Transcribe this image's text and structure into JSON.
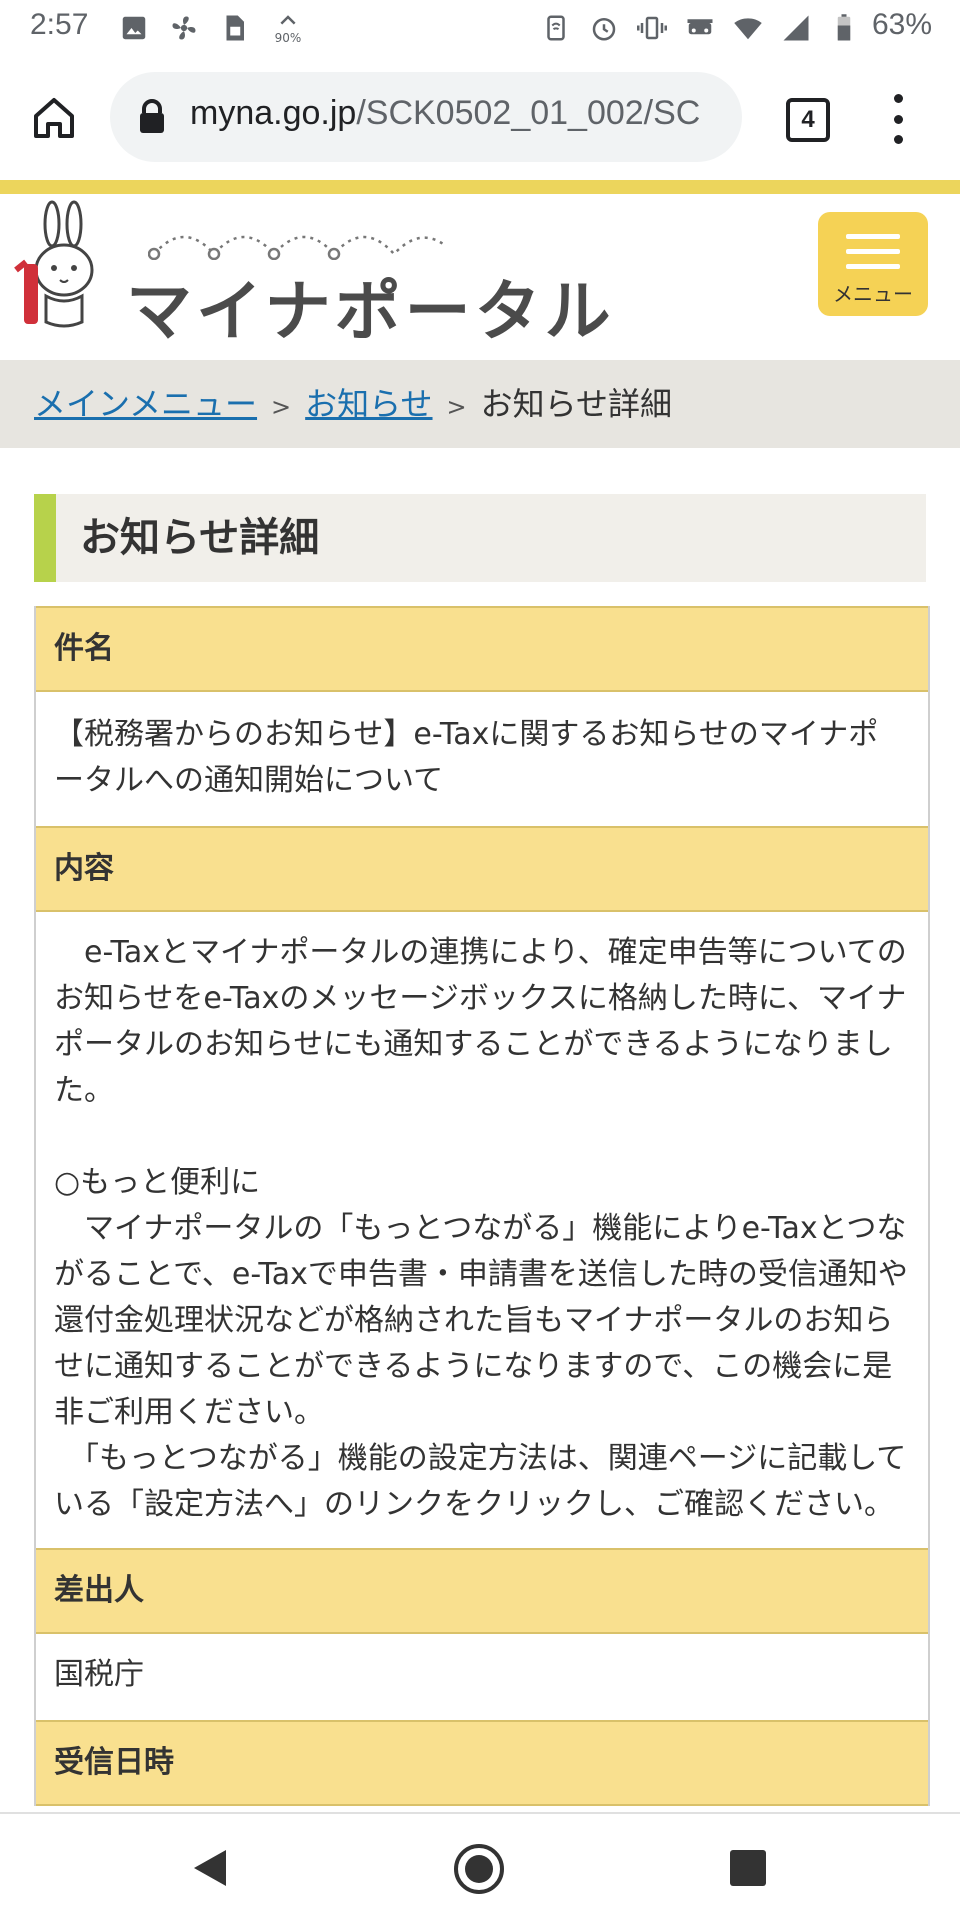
{
  "status_bar": {
    "time": "2:57",
    "battery_percent": "63%",
    "data_badge": "90%",
    "left_icons": [
      "image-icon",
      "fan-icon",
      "sim-icon",
      "data-saver-icon"
    ],
    "right_icons": [
      "nfc-icon",
      "alarm-icon",
      "vibrate-icon",
      "car-icon",
      "wifi-icon",
      "signal-icon",
      "battery-icon"
    ]
  },
  "browser": {
    "url_domain": "myna.go.jp",
    "url_path": "/SCK0502_01_002/SC",
    "tab_count": "4"
  },
  "site": {
    "logo_text": "マイナポータル",
    "menu_label": "メニュー",
    "brand_yellow": "#f5d255",
    "accent_green": "#b7d24b"
  },
  "breadcrumb": {
    "items": [
      "メインメニュー",
      "お知らせ"
    ],
    "separator": ">",
    "current": "お知らせ詳細"
  },
  "page_title": "お知らせ詳細",
  "detail": {
    "subject_label": "件名",
    "subject": "【税務署からのお知らせ】e-Taxに関するお知らせのマイナポータルへの通知開始について",
    "content_label": "内容",
    "content_p1": "　e-Taxとマイナポータルの連携により、確定申告等についてのお知らせをe-Taxのメッセージボックスに格納した時に、マイナポータルのお知らせにも通知することができるようになりました。",
    "content_heading": "○もっと便利に",
    "content_p2": "　マイナポータルの「もっとつながる」機能によりe-Taxとつながることで、e-Taxで申告書・申請書を送信した時の受信通知や還付金処理状況などが格納された旨もマイナポータルのお知らせに通知することができるようになりますので、この機会に是非ご利用ください。",
    "content_p3": "　「もっとつながる」機能の設定方法は、関連ページに記載している「設定方法へ」のリンクをクリックし、ご確認ください。",
    "sender_label": "差出人",
    "sender": "国税庁",
    "received_label": "受信日時"
  }
}
